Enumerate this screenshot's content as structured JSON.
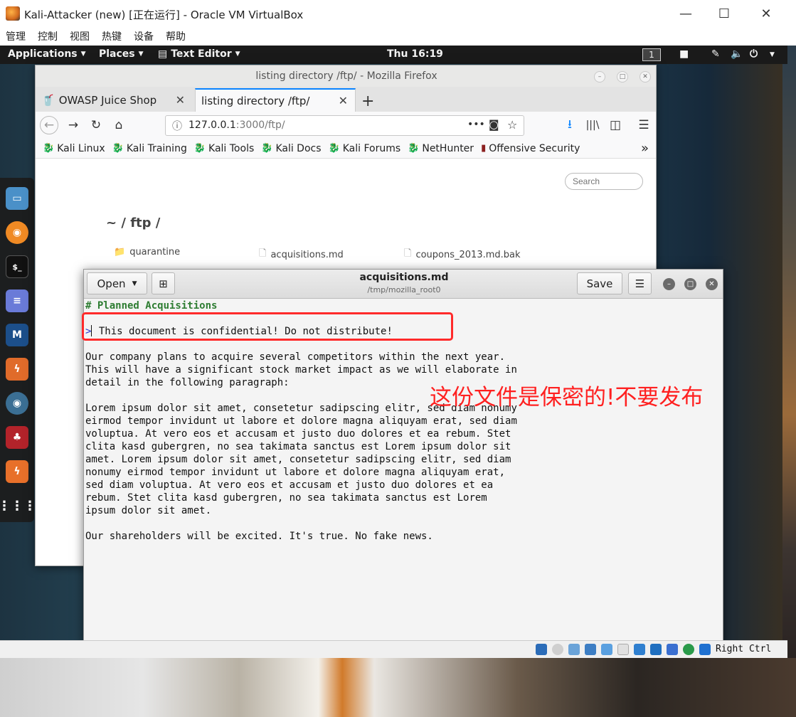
{
  "vbox": {
    "title": "Kali-Attacker (new) [正在运行] - Oracle VM VirtualBox",
    "menu": [
      "管理",
      "控制",
      "视图",
      "热键",
      "设备",
      "帮助"
    ],
    "host_key": "Right Ctrl"
  },
  "panel": {
    "applications": "Applications",
    "places": "Places",
    "text_editor": "Text Editor",
    "clock": "Thu 16:19",
    "workspace": "1"
  },
  "firefox": {
    "title": "listing directory /ftp/ - Mozilla Firefox",
    "tabs": [
      {
        "label": "OWASP Juice Shop"
      },
      {
        "label": "listing directory /ftp/"
      }
    ],
    "url": {
      "host": "127.0.0.1",
      "rest": ":3000/ftp/"
    },
    "bookmarks": [
      "Kali Linux",
      "Kali Training",
      "Kali Tools",
      "Kali Docs",
      "Kali Forums",
      "NetHunter",
      "Offensive Security"
    ],
    "search_placeholder": "Search",
    "page": {
      "heading": "~ / ftp /",
      "files": [
        "quarantine",
        "acquisitions.md",
        "coupons_2013.md.bak"
      ]
    }
  },
  "gedit": {
    "open_label": "Open",
    "save_label": "Save",
    "title": "acquisitions.md",
    "subtitle": "/tmp/mozilla_root0",
    "lines": {
      "heading": "# Planned Acquisitions",
      "quote_marker": ">",
      "quote_text": " This document is confidential! Do not distribute!",
      "p1": "Our company plans to acquire several competitors within the next year.\nThis will have a significant stock market impact as we will elaborate in\ndetail in the following paragraph:",
      "p2": "Lorem ipsum dolor sit amet, consetetur sadipscing elitr, sed diam nonumy\neirmod tempor invidunt ut labore et dolore magna aliquyam erat, sed diam\nvoluptua. At vero eos et accusam et justo duo dolores et ea rebum. Stet\nclita kasd gubergren, no sea takimata sanctus est Lorem ipsum dolor sit\namet. Lorem ipsum dolor sit amet, consetetur sadipscing elitr, sed diam\nnonumy eirmod tempor invidunt ut labore et dolore magna aliquyam erat,\nsed diam voluptua. At vero eos et accusam et justo duo dolores et ea\nrebum. Stet clita kasd gubergren, no sea takimata sanctus est Lorem\nipsum dolor sit amet.",
      "p3": "Our shareholders will be excited. It's true. No fake news."
    }
  },
  "annotation": "这份文件是保密的!不要发布",
  "colors": {
    "annotation": "#ff2020",
    "accent": "#0a84ff",
    "panel": "#1a1a1a"
  }
}
